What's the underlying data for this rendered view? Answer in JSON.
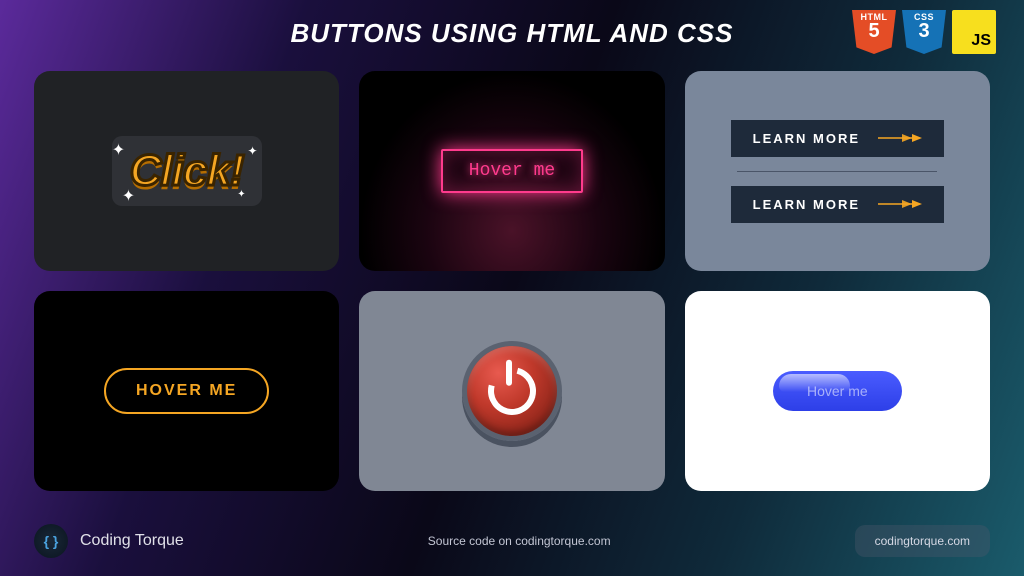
{
  "page": {
    "title": "BUTTONS USING HTML AND CSS"
  },
  "tech": {
    "html": {
      "label": "HTML",
      "version": "5"
    },
    "css": {
      "label": "CSS",
      "version": "3"
    },
    "js": {
      "label": "JS"
    }
  },
  "cards": {
    "click": {
      "label": "Click!"
    },
    "neon": {
      "label": "Hover me"
    },
    "learn": {
      "label1": "LEARN MORE",
      "label2": "LEARN MORE"
    },
    "pill": {
      "label": "HOVER ME"
    },
    "power": {
      "icon": "power-icon"
    },
    "bluepill": {
      "label": "Hover me"
    }
  },
  "footer": {
    "brand_name": "Coding Torque",
    "brand_glyph": "{ }",
    "source_text": "Source code on codingtorque.com",
    "url": "codingtorque.com"
  }
}
